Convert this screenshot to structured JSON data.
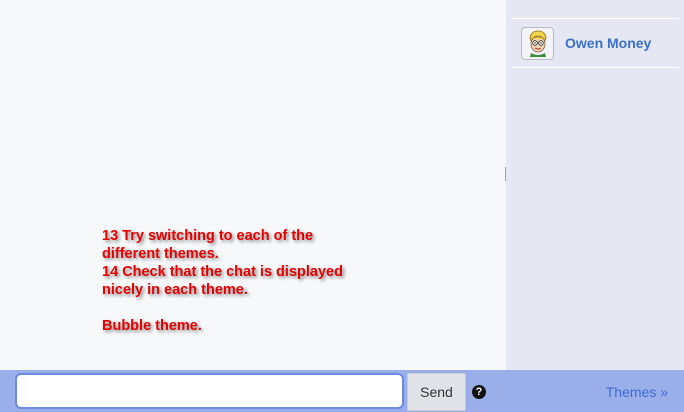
{
  "users": [
    {
      "name": "Owen Money",
      "avatar_icon": "cartoon-avatar-icon"
    }
  ],
  "annotation": {
    "line1": "13 Try switching to each of the",
    "line2": "different themes.",
    "line3": "14 Check that the chat is displayed",
    "line4": "nicely in each theme.",
    "line5": "Bubble theme."
  },
  "input": {
    "value": "",
    "placeholder": ""
  },
  "send_label": "Send",
  "help_icon": "?",
  "themes_label": "Themes »",
  "colors": {
    "bottom_bar": "#9aaee9",
    "user_panel": "#e5e8f2",
    "link": "#3e6ed1",
    "annotation": "#e80000"
  }
}
